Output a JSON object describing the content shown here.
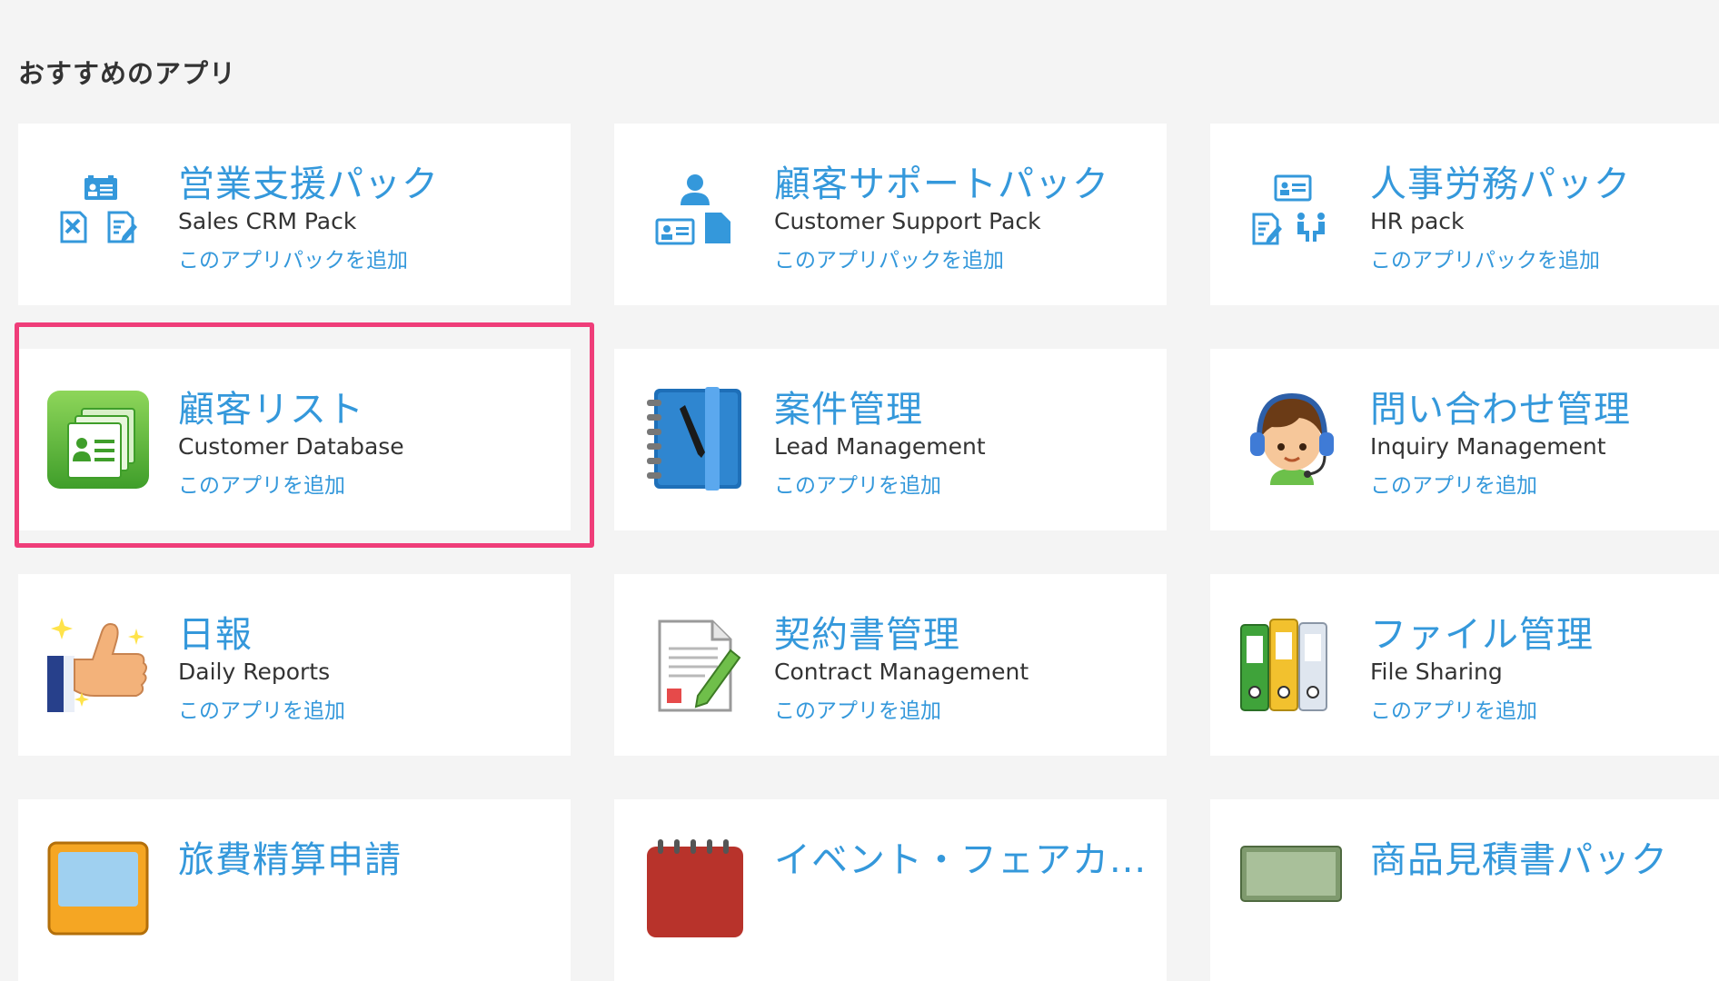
{
  "section": {
    "title": "おすすめのアプリ"
  },
  "rows": [
    [
      {
        "name": "card-sales-crm-pack",
        "icon": "sales-pack-icon",
        "title": "営業支援パック",
        "subtitle": "Sales CRM Pack",
        "action": "このアプリパックを追加"
      },
      {
        "name": "card-customer-support-pack",
        "icon": "support-pack-icon",
        "title": "顧客サポートパック",
        "subtitle": "Customer Support Pack",
        "action": "このアプリパックを追加"
      },
      {
        "name": "card-hr-pack",
        "icon": "hr-pack-icon",
        "title": "人事労務パック",
        "subtitle": "HR pack",
        "action": "このアプリパックを追加"
      }
    ],
    [
      {
        "name": "card-customer-database",
        "icon": "customer-card-icon",
        "title": "顧客リスト",
        "subtitle": "Customer Database",
        "action": "このアプリを追加"
      },
      {
        "name": "card-lead-management",
        "icon": "notebook-pen-icon",
        "title": "案件管理",
        "subtitle": "Lead Management",
        "action": "このアプリを追加"
      },
      {
        "name": "card-inquiry-management",
        "icon": "headset-operator-icon",
        "title": "問い合わせ管理",
        "subtitle": "Inquiry Management",
        "action": "このアプリを追加"
      }
    ],
    [
      {
        "name": "card-daily-reports",
        "icon": "thumbs-up-icon",
        "title": "日報",
        "subtitle": "Daily Reports",
        "action": "このアプリを追加"
      },
      {
        "name": "card-contract-management",
        "icon": "document-pen-icon",
        "title": "契約書管理",
        "subtitle": "Contract Management",
        "action": "このアプリを追加"
      },
      {
        "name": "card-file-sharing",
        "icon": "binders-icon",
        "title": "ファイル管理",
        "subtitle": "File Sharing",
        "action": "このアプリを追加"
      }
    ],
    [
      {
        "name": "card-travel-expense",
        "icon": "travel-expense-icon",
        "title": "旅費精算申請"
      },
      {
        "name": "card-event-fair",
        "icon": "calendar-icon",
        "title": "イベント・フェアカ..."
      },
      {
        "name": "card-quote-pack",
        "icon": "money-icon",
        "title": "商品見積書パック"
      }
    ]
  ],
  "colors": {
    "link": "#3498db",
    "highlight": "#ef3d79",
    "background": "#f4f4f4"
  }
}
